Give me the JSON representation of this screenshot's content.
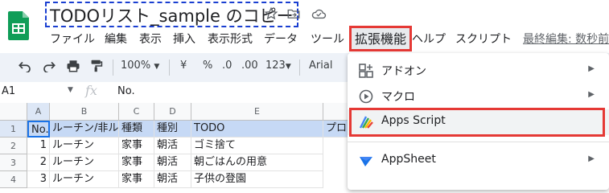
{
  "doc": {
    "title": "TODOリスト_sample のコピー"
  },
  "menubar": [
    {
      "key": "file",
      "label": "ファイル"
    },
    {
      "key": "edit",
      "label": "編集"
    },
    {
      "key": "view",
      "label": "表示"
    },
    {
      "key": "insert",
      "label": "挿入"
    },
    {
      "key": "format",
      "label": "表示形式"
    },
    {
      "key": "data",
      "label": "データ"
    },
    {
      "key": "tools",
      "label": "ツール"
    },
    {
      "key": "extensions",
      "label": "拡張機能"
    },
    {
      "key": "help",
      "label": "ヘルプ"
    },
    {
      "key": "script",
      "label": "スクリプト"
    }
  ],
  "last_edit": "最終編集: 数秒前",
  "toolbar": {
    "zoom": "100%",
    "currency": "¥",
    "percent": "%",
    "dec_dec": ".0",
    "inc_dec": ".00",
    "more_formats": "123",
    "font": "Arial"
  },
  "formula_bar": {
    "cell": "A1",
    "fx": "fx",
    "value": "No."
  },
  "grid": {
    "columns": [
      "A",
      "B",
      "C",
      "D",
      "E"
    ],
    "rows": [
      {
        "num": "1",
        "cells": [
          "No.",
          "ルーチン/非ルーチン",
          "種類",
          "種別",
          "TODO",
          "プロ"
        ]
      },
      {
        "num": "2",
        "cells": [
          "1",
          "ルーチン",
          "家事",
          "朝活",
          "ゴミ捨て",
          ""
        ]
      },
      {
        "num": "3",
        "cells": [
          "2",
          "ルーチン",
          "家事",
          "朝活",
          "朝ごはんの用意",
          ""
        ]
      },
      {
        "num": "4",
        "cells": [
          "3",
          "ルーチン",
          "家事",
          "朝活",
          "子供の登園",
          ""
        ]
      }
    ]
  },
  "ext_menu": {
    "items": [
      {
        "key": "addon",
        "label": "アドオン",
        "submenu": true
      },
      {
        "key": "macro",
        "label": "マクロ",
        "submenu": true
      },
      {
        "key": "apps_script",
        "label": "Apps Script",
        "submenu": false
      },
      {
        "key": "appsheet",
        "label": "AppSheet",
        "submenu": true
      }
    ]
  },
  "colors": {
    "highlight": "#e53935",
    "title_border": "#1a3fd1",
    "selected_row": "#c6d9f5",
    "sheets_green": "#0f9d58"
  }
}
